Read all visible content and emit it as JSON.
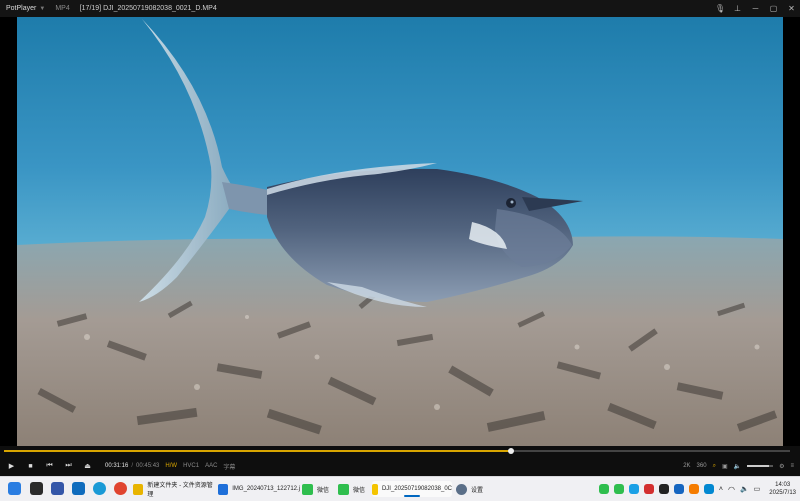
{
  "titlebar": {
    "app_name": "PotPlayer",
    "format": "MP4",
    "file_title": "[17/19] DJI_20250719082038_0021_D.MP4"
  },
  "player": {
    "time_current": "00:31:16",
    "time_separator": "/",
    "time_total": "00:45:43",
    "tag_hw": "H/W",
    "tag_codec": "HVC1",
    "tag_audio": "AAC",
    "tag_sub": "字幕",
    "progress": 0.645,
    "volume": 0.85,
    "right_labels": [
      "2K",
      "360"
    ]
  },
  "taskbar": {
    "items": [
      {
        "label": "新建文件夹 - 文件资源管理",
        "color": "#e8b400"
      },
      {
        "label": "IMG_20240713_122712.j",
        "color": "#1e6fd9"
      },
      {
        "label": "微信",
        "color": "#2fbe4e"
      },
      {
        "label": "微信",
        "color": "#2fbe4e"
      },
      {
        "label": "DJI_20250719082038_0C",
        "color": "#f4c400"
      },
      {
        "label": "设置",
        "color": "#5a6e88"
      }
    ],
    "clock_time": "14:03",
    "clock_date": "2025/7/13"
  }
}
